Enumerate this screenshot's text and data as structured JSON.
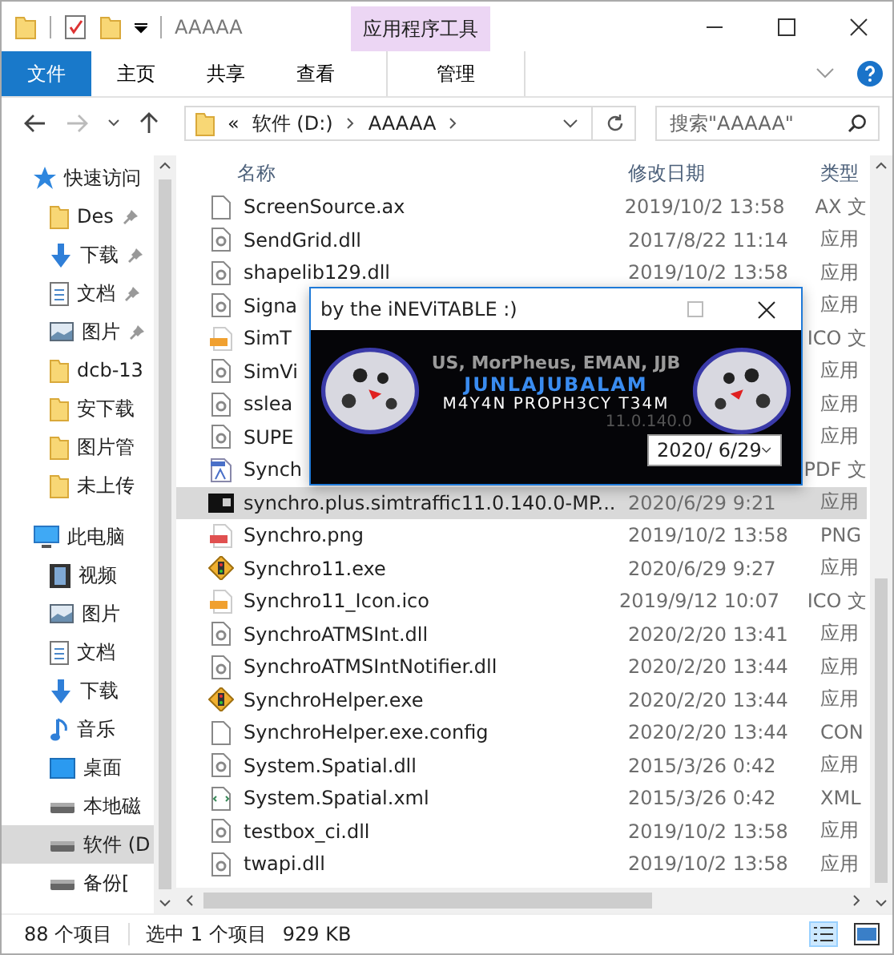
{
  "window": {
    "title": "AAAAA",
    "context_tab_header": "应用程序工具"
  },
  "ribbon_tabs": [
    {
      "label": "文件",
      "kind": "file",
      "selected": false
    },
    {
      "label": "主页",
      "kind": "tab",
      "selected": false
    },
    {
      "label": "共享",
      "kind": "tab",
      "selected": false
    },
    {
      "label": "查看",
      "kind": "tab",
      "selected": false
    },
    {
      "label": "管理",
      "kind": "context",
      "selected": false
    }
  ],
  "address": {
    "overflow": "«",
    "segments": [
      "软件 (D:)",
      "AAAAA"
    ]
  },
  "search": {
    "placeholder": "搜索\"AAAAA\""
  },
  "sidebar": {
    "items": [
      {
        "label": "快速访问",
        "kind": "star",
        "pinned": false,
        "selected": false,
        "group": true
      },
      {
        "label": "Des",
        "kind": "folder",
        "pinned": true,
        "selected": false,
        "group": false
      },
      {
        "label": "下载",
        "kind": "download",
        "pinned": true,
        "selected": false,
        "group": false
      },
      {
        "label": "文档",
        "kind": "doc",
        "pinned": true,
        "selected": false,
        "group": false
      },
      {
        "label": "图片",
        "kind": "picture",
        "pinned": true,
        "selected": false,
        "group": false
      },
      {
        "label": "dcb-13",
        "kind": "folder",
        "pinned": false,
        "selected": false,
        "group": false
      },
      {
        "label": "安下载",
        "kind": "folder",
        "pinned": false,
        "selected": false,
        "group": false
      },
      {
        "label": "图片管",
        "kind": "folder",
        "pinned": false,
        "selected": false,
        "group": false
      },
      {
        "label": "未上传",
        "kind": "folder",
        "pinned": false,
        "selected": false,
        "group": false
      },
      {
        "label": "此电脑",
        "kind": "pc",
        "pinned": false,
        "selected": false,
        "group": true
      },
      {
        "label": "视频",
        "kind": "video",
        "pinned": false,
        "selected": false,
        "group": false
      },
      {
        "label": "图片",
        "kind": "picture",
        "pinned": false,
        "selected": false,
        "group": false
      },
      {
        "label": "文档",
        "kind": "doc",
        "pinned": false,
        "selected": false,
        "group": false
      },
      {
        "label": "下载",
        "kind": "download",
        "pinned": false,
        "selected": false,
        "group": false
      },
      {
        "label": "音乐",
        "kind": "music",
        "pinned": false,
        "selected": false,
        "group": false
      },
      {
        "label": "桌面",
        "kind": "desktop",
        "pinned": false,
        "selected": false,
        "group": false
      },
      {
        "label": "本地磁",
        "kind": "drive",
        "pinned": false,
        "selected": false,
        "group": false
      },
      {
        "label": "软件 (D",
        "kind": "drive",
        "pinned": false,
        "selected": true,
        "group": false
      },
      {
        "label": "备份[",
        "kind": "drive",
        "pinned": false,
        "selected": false,
        "group": false
      }
    ]
  },
  "table": {
    "columns": [
      "名称",
      "修改日期",
      "类型"
    ],
    "rows": [
      {
        "name": "ScreenSource.ax",
        "date": "2019/10/2 13:58",
        "type": "AX 文",
        "kind": "file",
        "selected": false
      },
      {
        "name": "SendGrid.dll",
        "date": "2017/8/22 11:14",
        "type": "应用",
        "kind": "dll",
        "selected": false
      },
      {
        "name": "shapelib129.dll",
        "date": "2019/10/2 13:58",
        "type": "应用",
        "kind": "dll",
        "selected": false
      },
      {
        "name": "Signa",
        "type": "应用",
        "kind": "dll",
        "selected": false
      },
      {
        "name": "SimT",
        "type": "ICO 文",
        "kind": "ico",
        "selected": false
      },
      {
        "name": "SimVi",
        "type": "应用",
        "kind": "dll",
        "selected": false
      },
      {
        "name": "sslea",
        "type": "应用",
        "kind": "dll",
        "selected": false
      },
      {
        "name": "SUPE",
        "type": "应用",
        "kind": "dll",
        "selected": false
      },
      {
        "name": "Synch",
        "type": "PDF 文",
        "kind": "pdf",
        "selected": false
      },
      {
        "name": "synchro.plus.simtraffic11.0.140.0-MP...",
        "date": "2020/6/29 9:21",
        "type": "应用",
        "kind": "image",
        "selected": true
      },
      {
        "name": "Synchro.png",
        "date": "2019/10/2 13:58",
        "type": "PNG",
        "kind": "png",
        "selected": false
      },
      {
        "name": "Synchro11.exe",
        "date": "2020/6/29 9:27",
        "type": "应用",
        "kind": "exe",
        "selected": false
      },
      {
        "name": "Synchro11_Icon.ico",
        "date": "2019/9/12 10:07",
        "type": "ICO 文",
        "kind": "ico",
        "selected": false
      },
      {
        "name": "SynchroATMSInt.dll",
        "date": "2020/2/20 13:41",
        "type": "应用",
        "kind": "dll",
        "selected": false
      },
      {
        "name": "SynchroATMSIntNotifier.dll",
        "date": "2020/2/20 13:44",
        "type": "应用",
        "kind": "dll",
        "selected": false
      },
      {
        "name": "SynchroHelper.exe",
        "date": "2020/2/20 13:44",
        "type": "应用",
        "kind": "exe",
        "selected": false
      },
      {
        "name": "SynchroHelper.exe.config",
        "date": "2020/2/20 13:44",
        "type": "CON",
        "kind": "file",
        "selected": false
      },
      {
        "name": "System.Spatial.dll",
        "date": "2015/3/26 0:42",
        "type": "应用",
        "kind": "dll",
        "selected": false
      },
      {
        "name": "System.Spatial.xml",
        "date": "2015/3/26 0:42",
        "type": "XML",
        "kind": "xml",
        "selected": false
      },
      {
        "name": "testbox_ci.dll",
        "date": "2019/10/2 13:58",
        "type": "应用",
        "kind": "dll",
        "selected": false
      },
      {
        "name": "twapi.dll",
        "date": "2019/10/2 13:58",
        "type": "应用",
        "kind": "dll",
        "selected": false
      }
    ]
  },
  "status_bar": {
    "count": "88 个项目",
    "selection": "选中 1 个项目",
    "size": "929 KB"
  },
  "dialog": {
    "title": "by the iNEViTABLE :)",
    "credits": "US, MorPheus, EMAN, JJB",
    "group": "JUNLAJUBALAM",
    "team": "M4Y4N PROPH3CY T34M",
    "version": "11.0.140.0",
    "date": "2020/ 6/29"
  }
}
